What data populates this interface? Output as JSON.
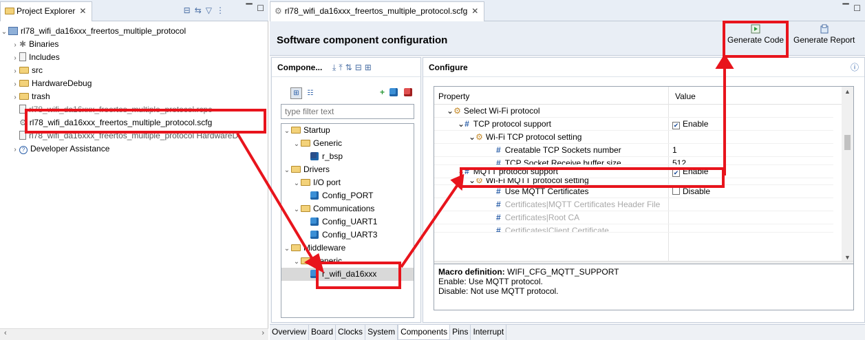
{
  "explorer": {
    "tab_label": "Project Explorer",
    "project": "rl78_wifi_da16xxx_freertos_multiple_protocol",
    "items": [
      "Binaries",
      "Includes",
      "src",
      "HardwareDebug",
      "trash",
      "rl78_wifi_da16xxx_freertos_multiple_protocol.rcpc",
      "rl78_wifi_da16xxx_freertos_multiple_protocol.scfg",
      "rl78_wifi_da16xxx_freertos_multiple_protocol HardwareD",
      "Developer Assistance"
    ]
  },
  "editor": {
    "tab_label": "rl78_wifi_da16xxx_freertos_multiple_protocol.scfg",
    "title": "Software component configuration",
    "generate_code": "Generate Code",
    "generate_report": "Generate Report"
  },
  "components": {
    "header": "Compone...",
    "filter_placeholder": "type filter text",
    "tree": {
      "startup": "Startup",
      "generic1": "Generic",
      "r_bsp": "r_bsp",
      "drivers": "Drivers",
      "io_port": "I/O port",
      "config_port": "Config_PORT",
      "communications": "Communications",
      "config_uart1": "Config_UART1",
      "config_uart3": "Config_UART3",
      "middleware": "Middleware",
      "generic2": "Generic",
      "r_wifi": "r_wifi_da16xxx"
    }
  },
  "configure": {
    "header": "Configure",
    "col_property": "Property",
    "col_value": "Value",
    "rows": [
      {
        "label": "Select Wi-Fi protocol",
        "value": ""
      },
      {
        "label": "TCP protocol support",
        "value": "Enable"
      },
      {
        "label": "Wi-Fi TCP protocol setting",
        "value": ""
      },
      {
        "label": "Creatable TCP Sockets number",
        "value": "1"
      },
      {
        "label": "TCP Socket Receive buffer size",
        "value": "512"
      },
      {
        "label": "MQTT protocol support",
        "value": "Enable"
      },
      {
        "label": "Wi-Fi MQTT protocol setting",
        "value": ""
      },
      {
        "label": "Use MQTT Certificates",
        "value": "Disable"
      },
      {
        "label": "Certificates|MQTT Certificates Header File",
        "value": ""
      },
      {
        "label": "Certificates|Root CA",
        "value": ""
      },
      {
        "label": "Certificates|Client Certificate",
        "value": ""
      }
    ],
    "macro_label": "Macro definition:",
    "macro_name": "WIFI_CFG_MQTT_SUPPORT",
    "macro_enable": "Enable: Use MQTT protocol.",
    "macro_disable": "Disable: Not use MQTT protocol."
  },
  "bottom_tabs": [
    "Overview",
    "Board",
    "Clocks",
    "System",
    "Components",
    "Pins",
    "Interrupt"
  ],
  "colors": {
    "highlight": "#e8141c",
    "accent": "#2a5ea8"
  }
}
